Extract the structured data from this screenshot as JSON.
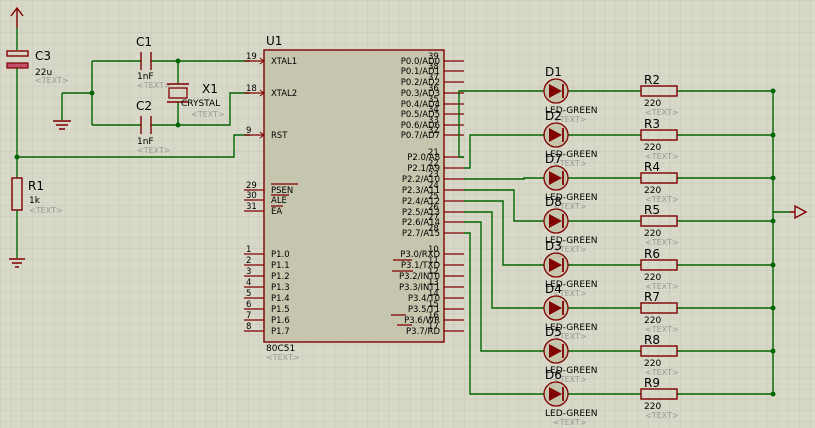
{
  "ui": {
    "grid_color": "#c3c3b3",
    "background": "#d8d8c8",
    "wire_color": "#006600",
    "component_color": "#800000",
    "chip_fill": "#c6c6ae",
    "placeholder_color": "#9a9a9a"
  },
  "labels": {
    "text_placeholder": "<TEXT>",
    "u1": {
      "ref": "U1",
      "part": "80C51"
    },
    "c1": {
      "ref": "C1",
      "value": "1nF"
    },
    "c2": {
      "ref": "C2",
      "value": "1nF"
    },
    "c3": {
      "ref": "C3",
      "value": "22u"
    },
    "x1": {
      "ref": "X1",
      "value": "CRYSTAL"
    },
    "r1": {
      "ref": "R1",
      "value": "1k"
    }
  },
  "u1_left_pins": [
    {
      "num": "19",
      "name": "XTAL1"
    },
    {
      "num": "18",
      "name": "XTAL2"
    },
    {
      "num": "9",
      "name": "RST"
    },
    {
      "num": "29",
      "name": "PSEN"
    },
    {
      "num": "30",
      "name": "ALE"
    },
    {
      "num": "31",
      "name": "EA"
    },
    {
      "num": "1",
      "name": "P1.0"
    },
    {
      "num": "2",
      "name": "P1.1"
    },
    {
      "num": "3",
      "name": "P1.2"
    },
    {
      "num": "4",
      "name": "P1.3"
    },
    {
      "num": "5",
      "name": "P1.4"
    },
    {
      "num": "6",
      "name": "P1.5"
    },
    {
      "num": "7",
      "name": "P1.6"
    },
    {
      "num": "8",
      "name": "P1.7"
    }
  ],
  "u1_right_pins": [
    {
      "num": "39",
      "name": "P0.0/AD0"
    },
    {
      "num": "38",
      "name": "P0.1/AD1"
    },
    {
      "num": "37",
      "name": "P0.2/AD2"
    },
    {
      "num": "36",
      "name": "P0.3/AD3"
    },
    {
      "num": "35",
      "name": "P0.4/AD4"
    },
    {
      "num": "34",
      "name": "P0.5/AD5"
    },
    {
      "num": "33",
      "name": "P0.6/AD6"
    },
    {
      "num": "32",
      "name": "P0.7/AD7"
    },
    {
      "num": "21",
      "name": "P2.0/A8"
    },
    {
      "num": "22",
      "name": "P2.1/A9"
    },
    {
      "num": "23",
      "name": "P2.2/A10"
    },
    {
      "num": "24",
      "name": "P2.3/A11"
    },
    {
      "num": "25",
      "name": "P2.4/A12"
    },
    {
      "num": "26",
      "name": "P2.5/A13"
    },
    {
      "num": "27",
      "name": "P2.6/A14"
    },
    {
      "num": "28",
      "name": "P2.7/A15"
    },
    {
      "num": "10",
      "name": "P3.0/RXD"
    },
    {
      "num": "11",
      "name": "P3.1/TXD"
    },
    {
      "num": "12",
      "name": "P3.2/INT0"
    },
    {
      "num": "13",
      "name": "P3.3/INT1"
    },
    {
      "num": "14",
      "name": "P3.4/T0"
    },
    {
      "num": "15",
      "name": "P3.5/T1"
    },
    {
      "num": "16",
      "name": "P3.6/WR"
    },
    {
      "num": "17",
      "name": "P3.7/RD"
    }
  ],
  "led_rows": [
    {
      "led": "D1",
      "led_value": "LED-GREEN",
      "res": "R2",
      "res_value": "220"
    },
    {
      "led": "D2",
      "led_value": "LED-GREEN",
      "res": "R3",
      "res_value": "220"
    },
    {
      "led": "D7",
      "led_value": "LED-GREEN",
      "res": "R4",
      "res_value": "220"
    },
    {
      "led": "D8",
      "led_value": "LED-GREEN",
      "res": "R5",
      "res_value": "220"
    },
    {
      "led": "D3",
      "led_value": "LED-GREEN",
      "res": "R6",
      "res_value": "220"
    },
    {
      "led": "D4",
      "led_value": "LED-GREEN",
      "res": "R7",
      "res_value": "220"
    },
    {
      "led": "D5",
      "led_value": "LED-GREEN",
      "res": "R8",
      "res_value": "220"
    },
    {
      "led": "D6",
      "led_value": "LED-GREEN",
      "res": "R9",
      "res_value": "220"
    }
  ]
}
